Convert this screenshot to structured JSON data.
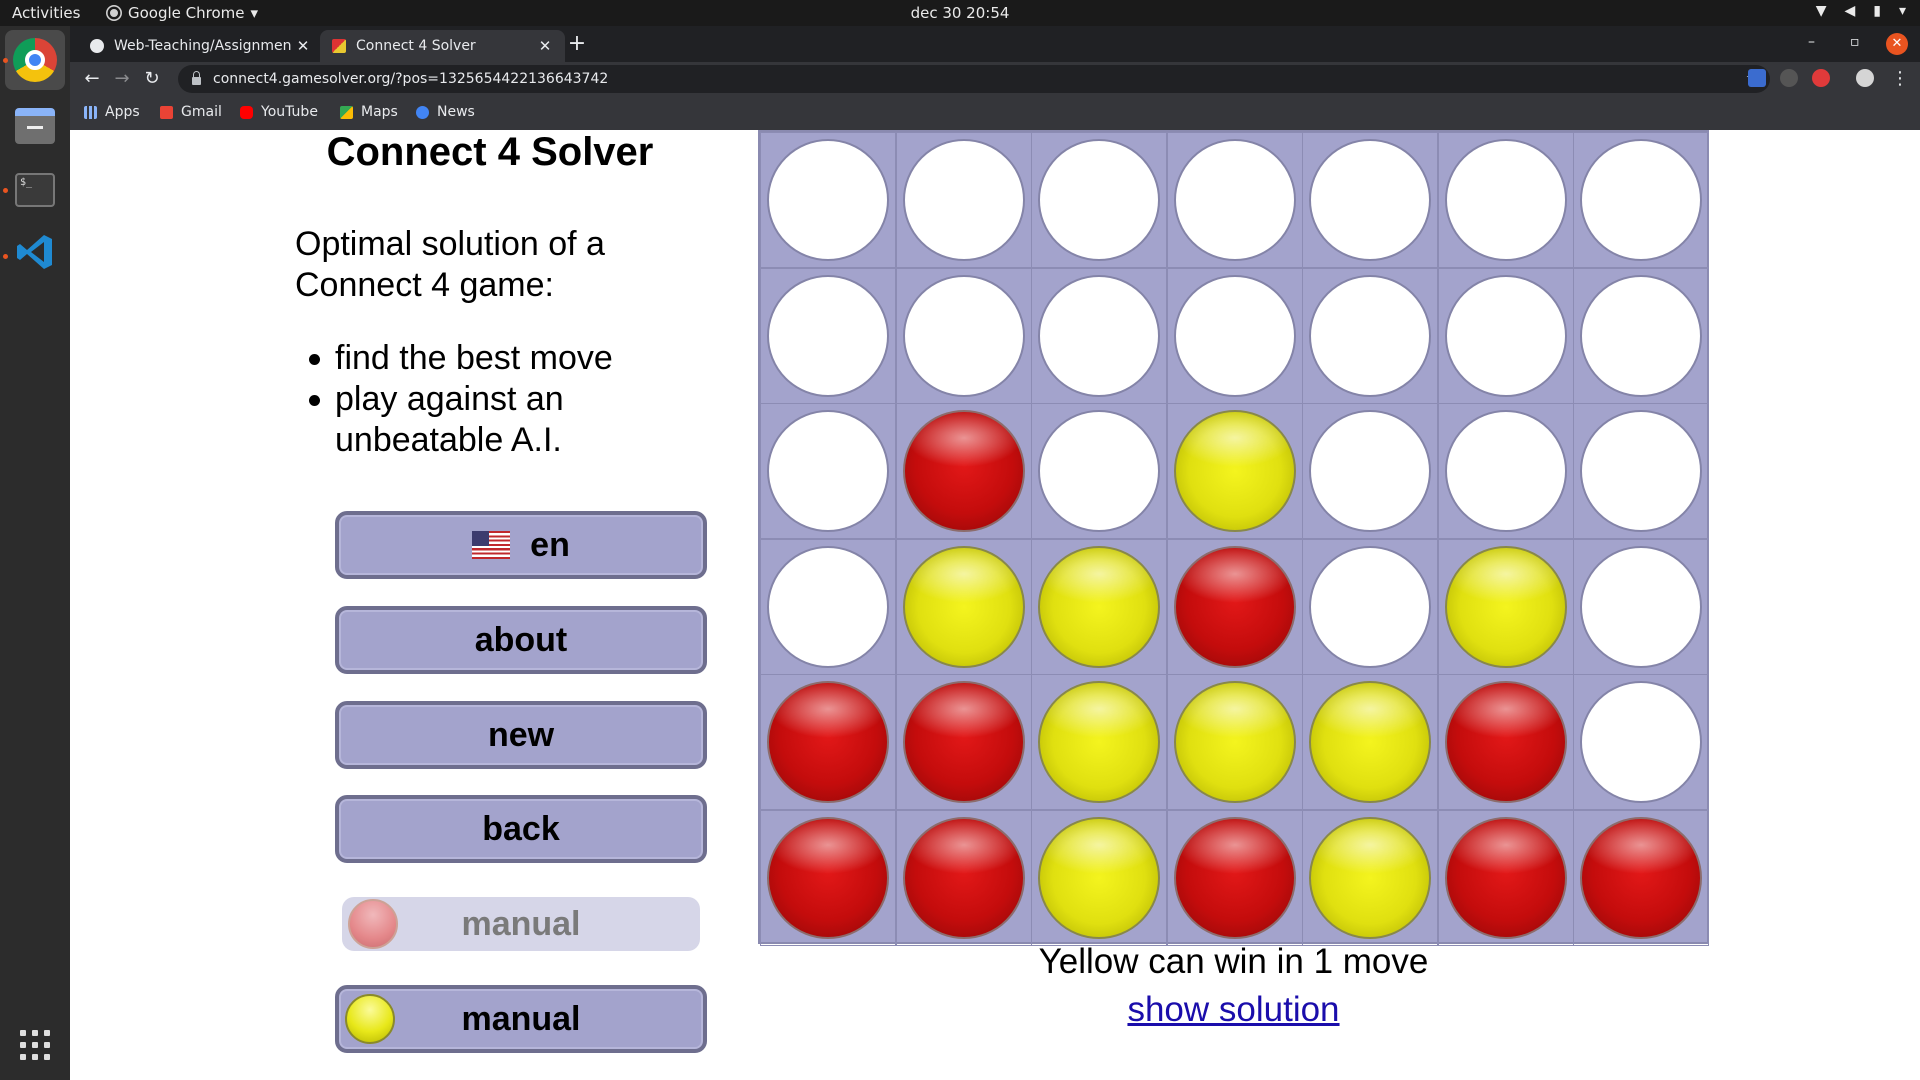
{
  "system": {
    "activities": "Activities",
    "app_name": "Google Chrome",
    "clock": "dec 30  20:54"
  },
  "browser": {
    "tabs": [
      {
        "title": "Web-Teaching/Assignmen"
      },
      {
        "title": "Connect 4 Solver"
      }
    ],
    "url": "connect4.gamesolver.org/?pos=1325654422136643742",
    "bookmarks": [
      "Apps",
      "Gmail",
      "YouTube",
      "Maps",
      "News"
    ]
  },
  "page": {
    "title": "Connect 4 Solver",
    "intro": "Optimal solution of a Connect 4 game:",
    "features": [
      "find the best move",
      "play against an unbeatable A.I."
    ],
    "buttons": {
      "language": "en",
      "about": "about",
      "new": "new",
      "back": "back",
      "red_player": "manual",
      "yellow_player": "manual"
    },
    "status": "Yellow can win in 1 move",
    "show_solution": "show solution"
  },
  "board": {
    "rows": [
      [
        "empty",
        "empty",
        "empty",
        "empty",
        "empty",
        "empty",
        "empty"
      ],
      [
        "empty",
        "empty",
        "empty",
        "empty",
        "empty",
        "empty",
        "empty"
      ],
      [
        "empty",
        "red",
        "empty",
        "yellow",
        "empty",
        "empty",
        "empty"
      ],
      [
        "empty",
        "yellow",
        "yellow",
        "red",
        "empty",
        "yellow",
        "empty"
      ],
      [
        "red",
        "red",
        "yellow",
        "yellow",
        "yellow",
        "red",
        "empty"
      ],
      [
        "red",
        "red",
        "yellow",
        "red",
        "yellow",
        "red",
        "red"
      ]
    ]
  },
  "colors": {
    "board": "#a3a3cc",
    "red": "#c40c0c",
    "yellow": "#e0e010",
    "link": "#1a0dab"
  }
}
